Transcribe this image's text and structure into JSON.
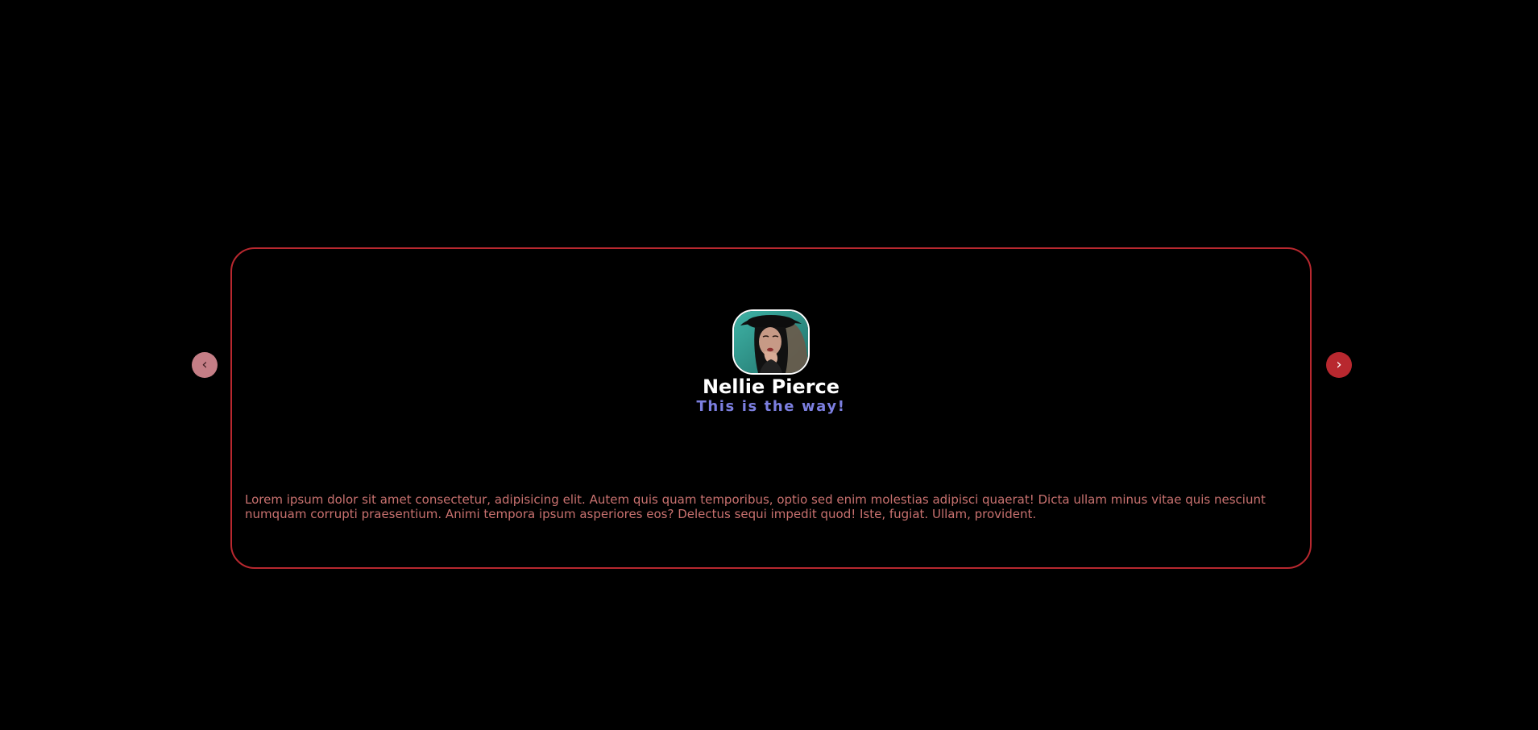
{
  "testimonial": {
    "name": "Nellie Pierce",
    "tagline": "This is the way!",
    "quote": "Lorem ipsum dolor sit amet consectetur, adipisicing elit. Autem quis quam temporibus, optio sed enim molestias adipisci quaerat! Dicta ullam minus vitae quis nesciunt numquam corrupti praesentium. Animi tempora ipsum asperiores eos? Delectus sequi impedit quod! Iste, fugiat. Ullam, provident."
  },
  "navigation": {
    "prev_label": "‹",
    "next_label": "›"
  },
  "colors": {
    "background": "#000000",
    "card_border": "#b8282f",
    "name": "#ffffff",
    "tagline": "#7c7fe0",
    "quote": "#c8716f",
    "prev_button": "#c57e86",
    "next_button": "#b8282f"
  }
}
